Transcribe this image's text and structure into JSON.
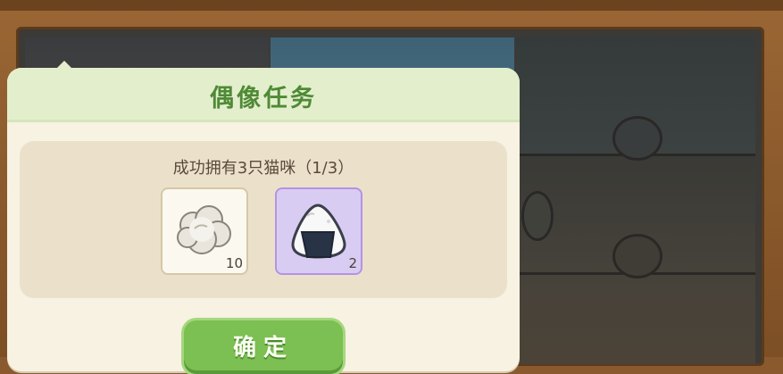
{
  "dialog": {
    "title": "偶像任务",
    "task_text": "成功拥有3只猫咪（1/3）",
    "items": [
      {
        "icon": "cotton-icon",
        "count": "10"
      },
      {
        "icon": "rice-ball-icon",
        "count": "2"
      }
    ],
    "confirm_label": "确定"
  },
  "colors": {
    "title_green": "#4f8a36",
    "button_green": "#7cbf52",
    "frame_wood": "#8a5a2e",
    "dialog_bg": "#f7f2e2",
    "rare_item_bg": "#d9ccf3"
  }
}
